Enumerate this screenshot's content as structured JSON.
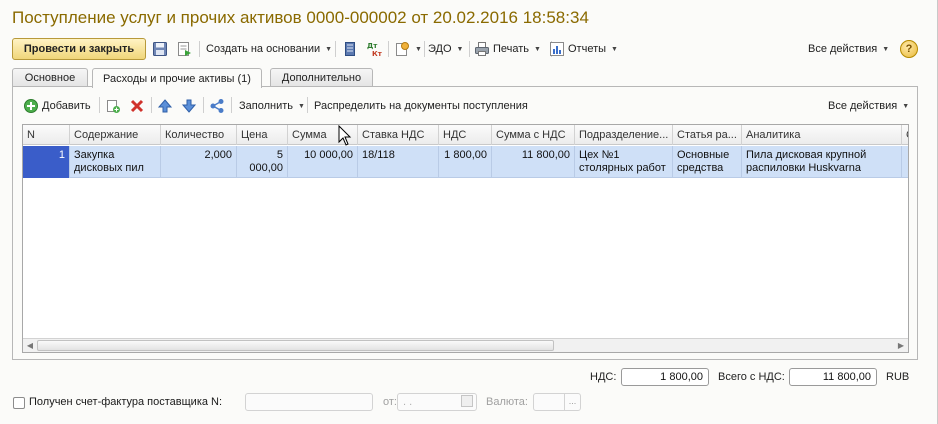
{
  "window": {
    "title": "Поступление услуг и прочих активов 0000-000002 от 20.02.2016 18:58:34"
  },
  "toolbar": {
    "post_close_label": "Провести и закрыть",
    "create_basis_label": "Создать на основании",
    "edo_label": "ЭДО",
    "print_label": "Печать",
    "reports_label": "Отчеты",
    "all_actions_label": "Все действия",
    "help_label": "?"
  },
  "tabs": [
    {
      "label": "Основное"
    },
    {
      "label": "Расходы и прочие активы (1)"
    },
    {
      "label": "Дополнительно"
    }
  ],
  "inner_toolbar": {
    "add_label": "Добавить",
    "fill_label": "Заполнить",
    "distribute_label": "Распределить на документы поступления",
    "all_actions_label": "Все действия"
  },
  "table": {
    "columns": [
      "N",
      "Содержание",
      "Количество",
      "Цена",
      "Сумма",
      "Ставка НДС",
      "НДС",
      "Сумма с НДС",
      "Подразделение...",
      "Статья ра...",
      "Аналитика",
      "С"
    ],
    "rows": [
      {
        "n": "1",
        "content": "Закупка дисковых пил",
        "qty": "2,000",
        "price": "5 000,00",
        "sum": "10 000,00",
        "vat_rate": "18/118",
        "vat": "1 800,00",
        "sum_vat": "11 800,00",
        "division": "Цех №1 столярных работ",
        "article": "Основные средства",
        "analytics": "Пила дисковая крупной распиловки Huskvarna"
      }
    ]
  },
  "totals": {
    "vat_label": "НДС:",
    "vat_value": "1 800,00",
    "total_label": "Всего с НДС:",
    "total_value": "11 800,00",
    "currency": "RUB"
  },
  "invoice": {
    "checkbox_label": "Получен счет-фактура поставщика N:",
    "from_label": "от:",
    "date_placeholder": " .  .",
    "currency_label": "Валюта:"
  }
}
